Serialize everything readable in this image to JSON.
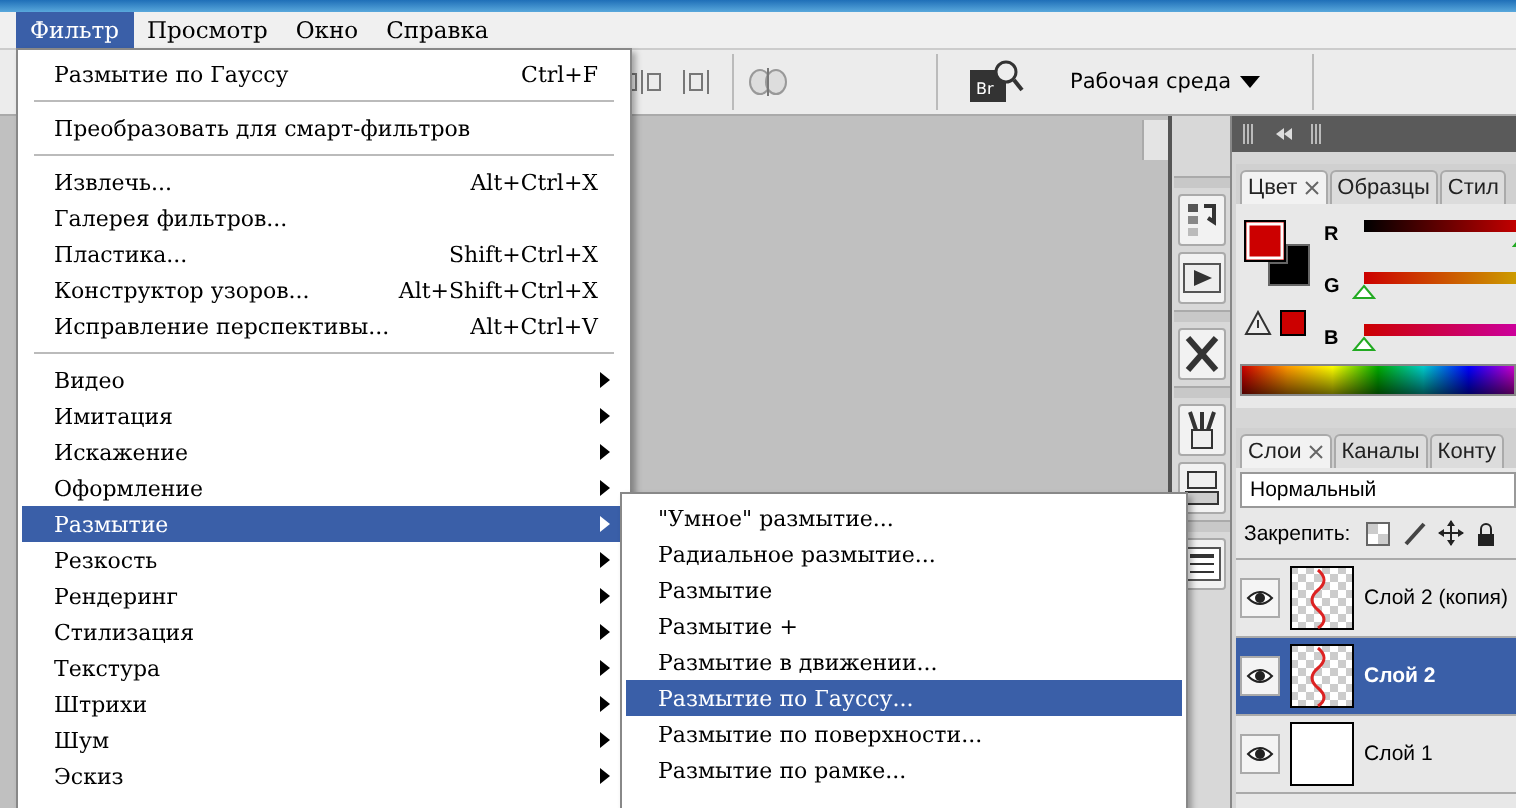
{
  "menubar": [
    {
      "label": "Фильтр",
      "selected": true
    },
    {
      "label": "Просмотр",
      "selected": false
    },
    {
      "label": "Окно",
      "selected": false
    },
    {
      "label": "Справка",
      "selected": false
    }
  ],
  "toolbar": {
    "bridge_label": "Br",
    "workspace_label": "Рабочая среда"
  },
  "filter_menu": [
    {
      "kind": "item",
      "label": "Размытие по Гауссу",
      "shortcut": "Ctrl+F",
      "has_submenu": false,
      "selected": false
    },
    {
      "kind": "separator"
    },
    {
      "kind": "item",
      "label": "Преобразовать для смарт-фильтров",
      "has_submenu": false,
      "selected": false
    },
    {
      "kind": "separator"
    },
    {
      "kind": "item",
      "label": "Извлечь...",
      "shortcut": "Alt+Ctrl+X",
      "has_submenu": false,
      "selected": false
    },
    {
      "kind": "item",
      "label": "Галерея фильтров...",
      "has_submenu": false,
      "selected": false
    },
    {
      "kind": "item",
      "label": "Пластика...",
      "shortcut": "Shift+Ctrl+X",
      "has_submenu": false,
      "selected": false
    },
    {
      "kind": "item",
      "label": "Конструктор узоров...",
      "shortcut": "Alt+Shift+Ctrl+X",
      "has_submenu": false,
      "selected": false
    },
    {
      "kind": "item",
      "label": "Исправление перспективы...",
      "shortcut": "Alt+Ctrl+V",
      "has_submenu": false,
      "selected": false
    },
    {
      "kind": "separator"
    },
    {
      "kind": "item",
      "label": "Видео",
      "has_submenu": true,
      "selected": false
    },
    {
      "kind": "item",
      "label": "Имитация",
      "has_submenu": true,
      "selected": false
    },
    {
      "kind": "item",
      "label": "Искажение",
      "has_submenu": true,
      "selected": false
    },
    {
      "kind": "item",
      "label": "Оформление",
      "has_submenu": true,
      "selected": false
    },
    {
      "kind": "item",
      "label": "Размытие",
      "has_submenu": true,
      "selected": true
    },
    {
      "kind": "item",
      "label": "Резкость",
      "has_submenu": true,
      "selected": false
    },
    {
      "kind": "item",
      "label": "Рендеринг",
      "has_submenu": true,
      "selected": false
    },
    {
      "kind": "item",
      "label": "Стилизация",
      "has_submenu": true,
      "selected": false
    },
    {
      "kind": "item",
      "label": "Текстура",
      "has_submenu": true,
      "selected": false
    },
    {
      "kind": "item",
      "label": "Штрихи",
      "has_submenu": true,
      "selected": false
    },
    {
      "kind": "item",
      "label": "Шум",
      "has_submenu": true,
      "selected": false
    },
    {
      "kind": "item",
      "label": "Эскиз",
      "has_submenu": true,
      "selected": false
    }
  ],
  "blur_submenu": [
    {
      "label": "\"Умное\" размытие...",
      "selected": false
    },
    {
      "label": "Радиальное размытие...",
      "selected": false
    },
    {
      "label": "Размытие",
      "selected": false
    },
    {
      "label": "Размытие +",
      "selected": false
    },
    {
      "label": "Размытие в движении...",
      "selected": false
    },
    {
      "label": "Размытие по Гауссу...",
      "selected": true
    },
    {
      "label": "Размытие по поверхности...",
      "selected": false
    },
    {
      "label": "Размытие по рамке...",
      "selected": false
    }
  ],
  "color_panel": {
    "tabs": [
      {
        "label": "Цвет",
        "selected": true,
        "closable": true
      },
      {
        "label": "Образцы",
        "selected": false,
        "closable": false
      },
      {
        "label": "Стил",
        "selected": false,
        "closable": false
      }
    ],
    "channels": [
      {
        "label": "R",
        "level": 0.8
      },
      {
        "label": "G",
        "level": 0
      },
      {
        "label": "B",
        "level": 0
      }
    ]
  },
  "layers_panel": {
    "tabs": [
      {
        "label": "Слои",
        "selected": true,
        "closable": true
      },
      {
        "label": "Каналы",
        "selected": false,
        "closable": false
      },
      {
        "label": "Конту",
        "selected": false,
        "closable": false
      }
    ],
    "blend_mode": "Нормальный",
    "lock_label": "Закрепить:",
    "layers": [
      {
        "name": "Слой 2 (копия)",
        "kind": "wave",
        "visible": true,
        "selected": false
      },
      {
        "name": "Слой 2",
        "kind": "wave",
        "visible": true,
        "selected": true
      },
      {
        "name": "Слой 1",
        "kind": "blank",
        "visible": true,
        "selected": false
      }
    ]
  }
}
